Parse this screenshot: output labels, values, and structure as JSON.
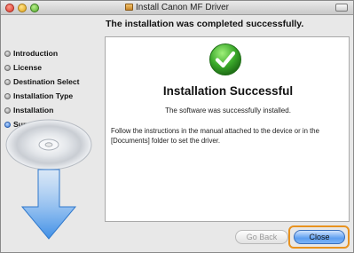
{
  "window": {
    "title": "Install Canon MF Driver"
  },
  "heading": "The installation was completed successfully.",
  "sidebar": {
    "steps": [
      {
        "label": "Introduction"
      },
      {
        "label": "License"
      },
      {
        "label": "Destination Select"
      },
      {
        "label": "Installation Type"
      },
      {
        "label": "Installation"
      },
      {
        "label": "Summary",
        "active": true
      }
    ]
  },
  "content": {
    "title": "Installation Successful",
    "subtitle": "The software was successfully installed.",
    "instructions": "Follow the instructions in the manual attached to the device or in the [Documents] folder to set the driver."
  },
  "buttons": {
    "back": "Go Back",
    "close": "Close"
  },
  "colors": {
    "focus_ring": "#e8921f",
    "default_button": "#5d9ef0",
    "success_check": "#3aa82a"
  },
  "icons": {
    "check": "check-icon",
    "cd": "cd-icon",
    "arrow": "down-arrow-icon",
    "package": "package-icon"
  }
}
